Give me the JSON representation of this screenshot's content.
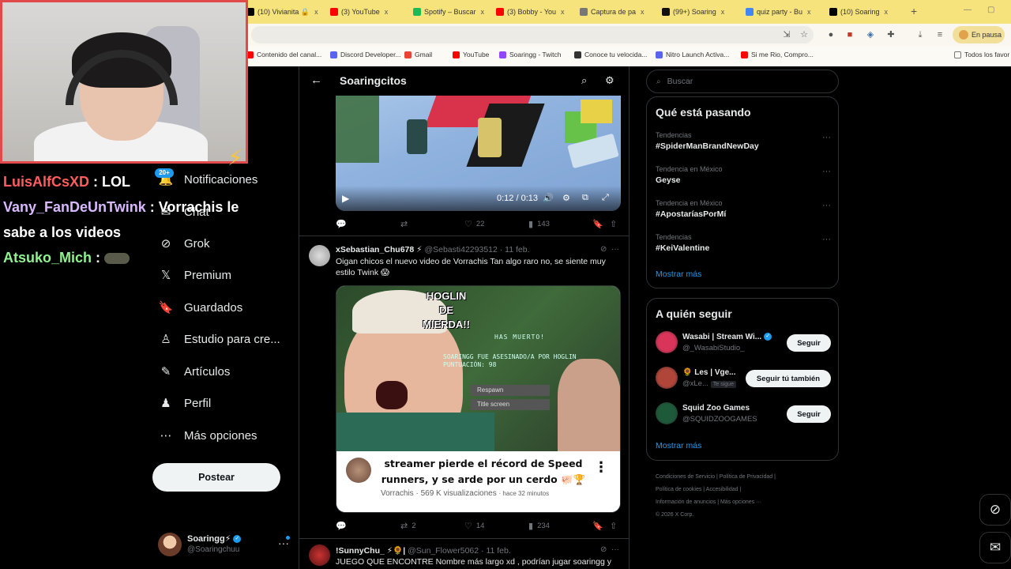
{
  "browser": {
    "tabs": [
      {
        "title": "(10) Vivianita 🔒",
        "color": "#000000"
      },
      {
        "title": "(3) YouTube",
        "color": "#ff0000"
      },
      {
        "title": "Spotify – Buscar",
        "color": "#1db954"
      },
      {
        "title": "(3) Bobby - You",
        "color": "#ff0000"
      },
      {
        "title": "Captura de pa",
        "color": "#777777"
      },
      {
        "title": "(99+) Soaring",
        "color": "#111111"
      },
      {
        "title": "quiz party - Bu",
        "color": "#4285f4"
      },
      {
        "title": "(10) Soaring",
        "color": "#000000"
      }
    ],
    "close_glyph": "x",
    "new_tab": "+",
    "profile_button": "En pausa",
    "bookmarks": [
      {
        "label": "Contenido del canal...",
        "color": "#ff0000"
      },
      {
        "label": "Discord Developer...",
        "color": "#5865f2"
      },
      {
        "label": "Gmail",
        "color": "#ea4335"
      },
      {
        "label": "YouTube",
        "color": "#ff0000"
      },
      {
        "label": "Soaringg - Twitch",
        "color": "#9146ff"
      },
      {
        "label": "Conoce tu velocida...",
        "color": "#333333"
      },
      {
        "label": "Nitro Launch Activa...",
        "color": "#5865f2"
      },
      {
        "label": "Si me Rio, Compro...",
        "color": "#ff0000"
      }
    ],
    "all_bookmarks": "Todos los favor"
  },
  "stream": {
    "chat": [
      {
        "user": "LuisAlfCsXD",
        "sep": " : ",
        "msg": "LOL"
      },
      {
        "user": "Vany_FanDeUnTwink",
        "sep": " : ",
        "msg": "Vorrachis le sabe a los videos"
      },
      {
        "user": "Atsuko_Mich",
        "sep": " : ",
        "msg": ""
      }
    ],
    "notif_badge": "20+"
  },
  "nav": {
    "items": [
      {
        "label": "Notificaciones",
        "icon": "bell-icon",
        "glyph": "🔔"
      },
      {
        "label": "Chat",
        "icon": "chat-icon",
        "glyph": "✉"
      },
      {
        "label": "Grok",
        "icon": "grok-icon",
        "glyph": "⊘"
      },
      {
        "label": "Premium",
        "icon": "x-logo-icon",
        "glyph": "𝕏"
      },
      {
        "label": "Guardados",
        "icon": "bookmark-icon",
        "glyph": "🔖"
      },
      {
        "label": "Estudio para cre...",
        "icon": "studio-icon",
        "glyph": "♙"
      },
      {
        "label": "Artículos",
        "icon": "articles-icon",
        "glyph": "✎"
      },
      {
        "label": "Perfil",
        "icon": "profile-icon",
        "glyph": "♟"
      },
      {
        "label": "Más opciones",
        "icon": "more-circle-icon",
        "glyph": "⋯"
      }
    ],
    "post_button": "Postear",
    "account": {
      "name": "Soaringg⚡",
      "handle": "@Soaringchuu"
    }
  },
  "timeline": {
    "title": "Soaringcitos",
    "video": {
      "time": "0:12 / 0:13"
    },
    "tweet0_actions": {
      "replies": "",
      "retweets": "",
      "likes": "22",
      "views": "143"
    },
    "tweet1": {
      "name": "xSebastian_Chu678 ⚡",
      "handle": "@Sebasti42293512",
      "date": "· 11 feb.",
      "text": "Oigan chicos el nuevo video de Vorrachis Tan algo raro no, se siente muy estilo Twink 😱",
      "thumb_title": "HOGLIN DE MIERDA!!",
      "thumb_sub1": "HAS MUERTO!",
      "thumb_sub2": "SOARINGG FUE ASESINADO/A POR HOGLIN",
      "thumb_sub3": "PUNTUACIÓN: 98",
      "thumb_btn1": "Respawn",
      "thumb_btn2": "Title screen",
      "yt_title": "streamer pierde el récord de Speed runners, y se arde por un cerdo 🐖🏆",
      "yt_channel": "Vorrachis",
      "yt_views": "569 K visualizaciones",
      "yt_time": "· hace 32 minutos",
      "actions": {
        "replies": "",
        "retweets": "2",
        "likes": "14",
        "views": "234"
      }
    },
    "tweet2": {
      "name": "!SunnyChu_ ⚡🌻|",
      "handle": "@Sun_Flower5062",
      "date": "· 11 feb.",
      "text": "JUEGO QUE ENCONTRE Nombre más largo xd , podrían jugar soaringg y los"
    }
  },
  "sidebar": {
    "search_placeholder": "Buscar",
    "trends_title": "Qué está pasando",
    "trends": [
      {
        "category": "Tendencias",
        "name": "#SpiderManBrandNewDay"
      },
      {
        "category": "Tendencia en México",
        "name": "Geyse"
      },
      {
        "category": "Tendencia en México",
        "name": "#ApostaríasPorMí"
      },
      {
        "category": "Tendencias",
        "name": "#KeiValentine"
      }
    ],
    "show_more": "Mostrar más",
    "follow_title": "A quién seguir",
    "follow": [
      {
        "name": "Wasabi | Stream Wi...",
        "handle": "@_WasabiStudio_",
        "button": "Seguir",
        "color": "#d9355a"
      },
      {
        "name": "🌻 Les | Vge...",
        "handle": "@xLe...",
        "tag": "Te sigue",
        "button": "Seguir tú también",
        "color": "#b0453a"
      },
      {
        "name": "Squid Zoo Games",
        "handle": "@SQUIDZOOGAMES",
        "button": "Seguir",
        "color": "#1d5a3a"
      }
    ],
    "footer": [
      "Condiciones de Servicio  |  Política de Privacidad  |",
      "Política de cookies  |  Accesibilidad  |",
      "Información de anuncios  |  Más opciones ···",
      "© 2026 X Corp."
    ]
  }
}
